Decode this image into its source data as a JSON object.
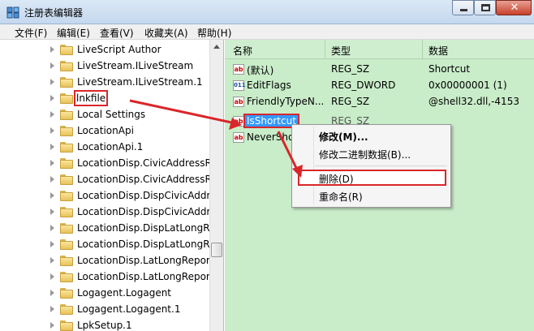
{
  "window": {
    "title": "注册表编辑器"
  },
  "menubar": [
    "文件(F)",
    "编辑(E)",
    "查看(V)",
    "收藏夹(A)",
    "帮助(H)"
  ],
  "tree": {
    "items": [
      "LiveScript Author",
      "LiveStream.ILiveStream",
      "LiveStream.ILiveStream.1",
      "lnkfile",
      "Local Settings",
      "LocationApi",
      "LocationApi.1",
      "LocationDisp.CivicAddressRe",
      "LocationDisp.CivicAddressRe",
      "LocationDisp.DispCivicAddre",
      "LocationDisp.DispCivicAddre",
      "LocationDisp.DispLatLongRe",
      "LocationDisp.DispLatLongRe",
      "LocationDisp.LatLongReport",
      "LocationDisp.LatLongReport",
      "Logagent.Logagent",
      "Logagent.Logagent.1",
      "LpkSetup.1"
    ],
    "selected": "lnkfile"
  },
  "values": {
    "headers": {
      "name": "名称",
      "type": "类型",
      "data": "数据"
    },
    "rows": [
      {
        "name": "(默认)",
        "type": "REG_SZ",
        "data": "Shortcut",
        "icon": "string-value-icon"
      },
      {
        "name": "EditFlags",
        "type": "REG_DWORD",
        "data": "0x00000001 (1)",
        "icon": "binary-value-icon"
      },
      {
        "name": "FriendlyTypeN...",
        "type": "REG_SZ",
        "data": "@shell32.dll,-4153",
        "icon": "string-value-icon"
      },
      {
        "name": "IsShortcut",
        "type": "REG_SZ",
        "data": "",
        "icon": "string-value-icon"
      },
      {
        "name": "NeverSho",
        "type": "",
        "data": "",
        "icon": "string-value-icon"
      }
    ],
    "selected": "IsShortcut"
  },
  "context_menu": {
    "items": [
      "修改(M)...",
      "修改二进制数据(B)...",
      "删除(D)",
      "重命名(R)"
    ],
    "highlighted": "删除(D)"
  },
  "colors": {
    "annotation": "#d9262a",
    "values_background": "#c9ecc9",
    "selection": "#3399ff"
  }
}
